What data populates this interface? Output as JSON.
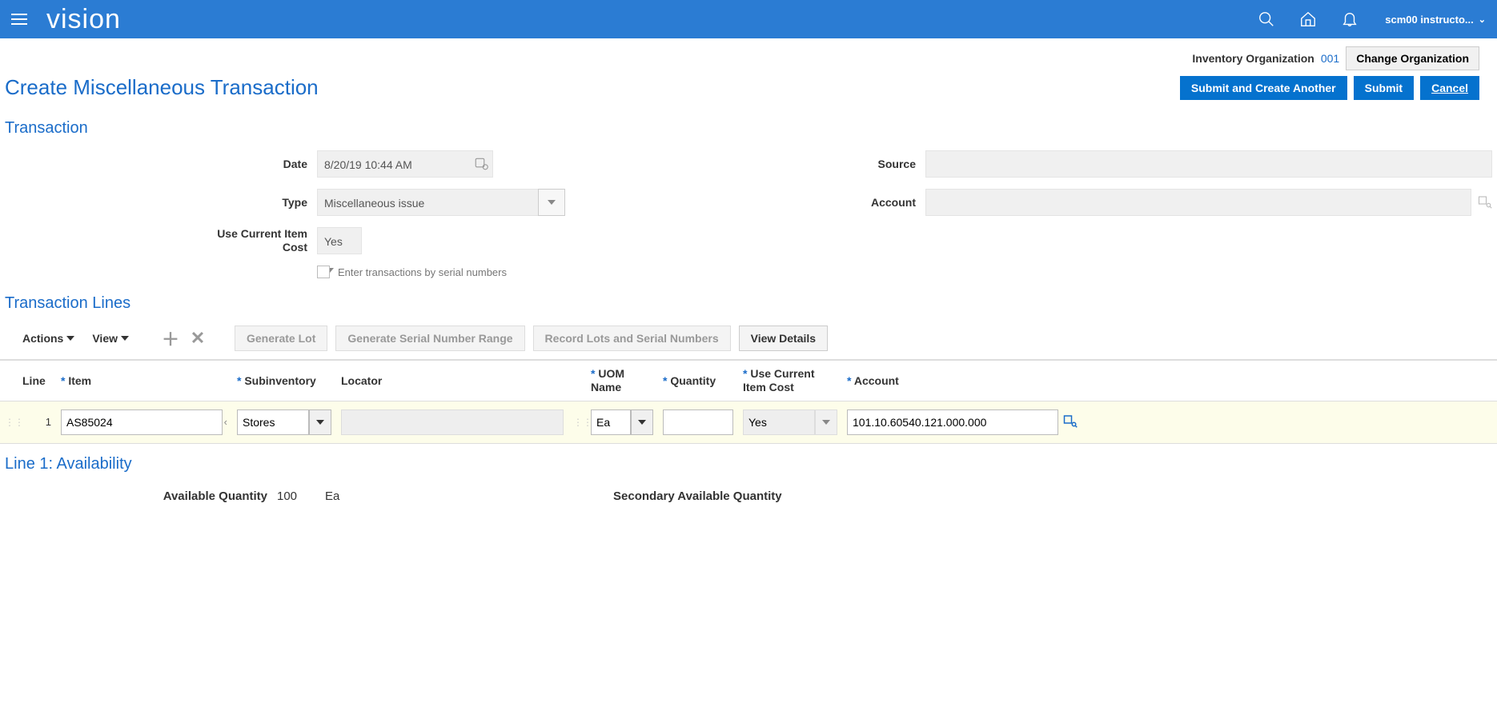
{
  "topbar": {
    "logo": "vision",
    "user": "scm00 instructo..."
  },
  "org": {
    "label": "Inventory Organization",
    "value": "001",
    "change_btn": "Change Organization"
  },
  "page": {
    "title": "Create Miscellaneous Transaction",
    "submit_another": "Submit and Create Another",
    "submit": "Submit",
    "cancel": "Cancel"
  },
  "transaction": {
    "header": "Transaction",
    "date_label": "Date",
    "date_value": "8/20/19 10:44 AM",
    "type_label": "Type",
    "type_value": "Miscellaneous issue",
    "cost_label": "Use Current Item Cost",
    "cost_value": "Yes",
    "serial_label": "Enter transactions by serial numbers",
    "source_label": "Source",
    "source_value": "",
    "account_label": "Account",
    "account_value": ""
  },
  "lines": {
    "header": "Transaction Lines",
    "actions": "Actions",
    "view": "View",
    "gen_lot": "Generate Lot",
    "gen_serial": "Generate Serial Number Range",
    "record": "Record Lots and Serial Numbers",
    "view_details": "View Details",
    "cols": {
      "line": "Line",
      "item": "Item",
      "subinv": "Subinventory",
      "locator": "Locator",
      "uom": "UOM Name",
      "qty": "Quantity",
      "cost": "Use Current Item Cost",
      "account": "Account"
    },
    "row": {
      "line": "1",
      "item": "AS85024",
      "subinv": "Stores",
      "locator": "",
      "uom": "Ea",
      "qty": "",
      "cost": "Yes",
      "account": "101.10.60540.121.000.000"
    }
  },
  "availability": {
    "header": "Line 1: Availability",
    "avail_label": "Available Quantity",
    "avail_qty": "100",
    "avail_uom": "Ea",
    "secondary_label": "Secondary Available Quantity"
  }
}
